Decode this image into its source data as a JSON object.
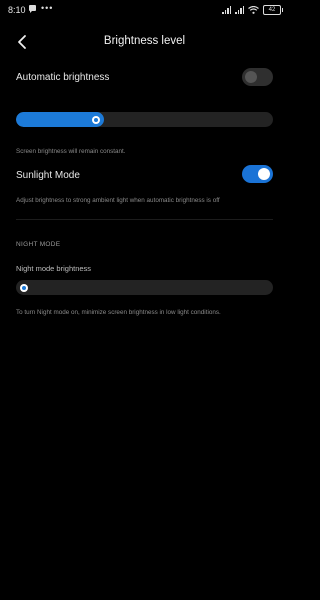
{
  "status_bar": {
    "time": "8:10",
    "battery": "42",
    "icons": [
      "chat-icon",
      "more-dots-icon",
      "signal-icon",
      "signal-icon",
      "wifi-icon",
      "battery-icon"
    ]
  },
  "header": {
    "title": "Brightness level",
    "back_icon": "back-arrow-icon"
  },
  "automatic_brightness": {
    "label": "Automatic brightness",
    "enabled": false
  },
  "brightness_slider": {
    "level": 0.3,
    "hint": "Screen brightness will remain constant."
  },
  "sunlight_mode": {
    "label": "Sunlight Mode",
    "enabled": true,
    "hint": "Adjust brightness to strong ambient light when automatic brightness is off"
  },
  "night_mode": {
    "section_title": "NIGHT MODE",
    "slider_label": "Night mode brightness",
    "level": 0.0,
    "hint": "To turn Night mode on, minimize screen brightness in low light conditions."
  },
  "colors": {
    "accent": "#1c7ad8",
    "background": "#000000"
  }
}
